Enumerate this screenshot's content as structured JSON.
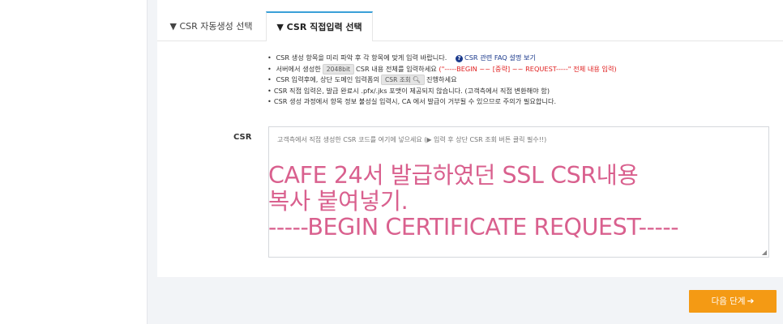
{
  "tabs": [
    {
      "label": "▼ CSR 자동생성 선택"
    },
    {
      "label": "▼ CSR 직접입력 선택"
    }
  ],
  "notes": {
    "line1_text": "CSR 생성 항목을 미리 파악 후 각 항목에 맞게 입력 바랍니다.",
    "faq_link": "CSR 관련 FAQ 설명 보기",
    "line2_prefix": "서버에서 생성한",
    "line2_chip": "2048bit",
    "line2_middle": "CSR 내용 전체를 입력하세요",
    "line2_red": "(\"-----BEGIN ~~ [중략] ~~ REQUEST-----\" 전체 내용 입력)",
    "line3_prefix": "CSR 입력후에, 상단 도메인 입력폼의",
    "line3_chip": "CSR 조회",
    "line3_suffix": "진행하세요",
    "line4": "CSR 직접 입력은, 발급 완료시 .pfx/.jks 포맷이 제공되지 않습니다. (고객측에서 직접 변환해야 함)",
    "line5": "CSR 생성 과정에서 항목 정보 불성실 입력시, CA 에서 발급이 거부될 수 있으므로 주의가 필요합니다."
  },
  "csr": {
    "label": "CSR",
    "placeholder": "고객측에서 직접 생성한 CSR 코드를 여기에 넣으세요 (▶ 입력 후 상단 CSR 조회 버튼 클릭 필수!!)",
    "overlay_line1": "CAFE 24서 발급하였던 SSL CSR내용",
    "overlay_line2": "복사 붙여넣기.",
    "overlay_line3": "-----BEGIN CERTIFICATE REQUEST-----"
  },
  "next_button": {
    "label": "다음 단계"
  },
  "icons": {
    "question": "question-circle-icon",
    "search": "magnifier-icon",
    "arrow": "arrow-right-icon"
  },
  "colors": {
    "accent_tab": "#3aa0d8",
    "next_button": "#f49a14",
    "overlay_text": "#d9608e",
    "warning": "#e02020",
    "link": "#1b3a8c"
  }
}
